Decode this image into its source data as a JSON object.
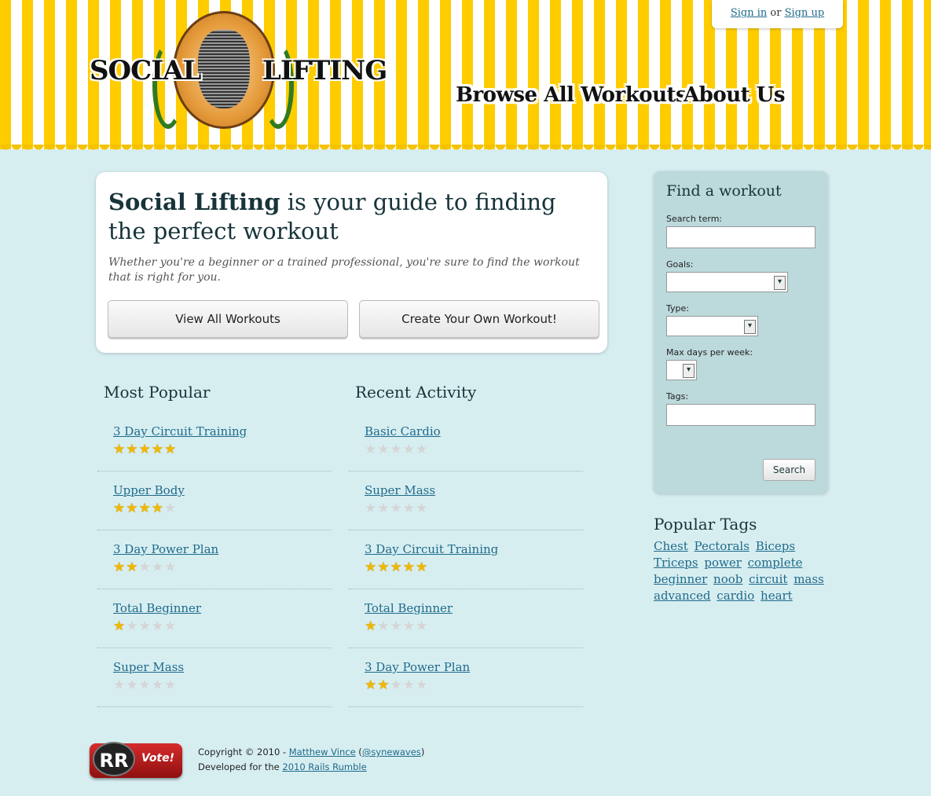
{
  "header": {
    "logo_left": "SOCIAL",
    "logo_right": "LIFTING",
    "auth": {
      "sign_in": "Sign in",
      "or": "or",
      "sign_up": "Sign up"
    },
    "nav": [
      {
        "label": "Browse All Workouts"
      },
      {
        "label": "About Us"
      }
    ]
  },
  "intro": {
    "headline_strong": "Social Lifting",
    "headline_rest": " is your guide to finding the perfect workout",
    "subtext": "Whether you're a beginner or a trained professional, you're sure to find the workout that is right for you.",
    "btn_view_all": "View All Workouts",
    "btn_create": "Create Your Own Workout!"
  },
  "most_popular": {
    "title": "Most Popular",
    "items": [
      {
        "name": "3 Day Circuit Training",
        "rating": 5
      },
      {
        "name": "Upper Body",
        "rating": 4
      },
      {
        "name": "3 Day Power Plan",
        "rating": 2
      },
      {
        "name": "Total Beginner",
        "rating": 1
      },
      {
        "name": "Super Mass",
        "rating": 0
      }
    ]
  },
  "recent_activity": {
    "title": "Recent Activity",
    "items": [
      {
        "name": "Basic Cardio",
        "rating": 0
      },
      {
        "name": "Super Mass",
        "rating": 0
      },
      {
        "name": "3 Day Circuit Training",
        "rating": 5
      },
      {
        "name": "Total Beginner",
        "rating": 1
      },
      {
        "name": "3 Day Power Plan",
        "rating": 2
      }
    ]
  },
  "find": {
    "title": "Find a workout",
    "search_term_label": "Search term:",
    "goals_label": "Goals:",
    "type_label": "Type:",
    "max_days_label": "Max days per week:",
    "tags_label": "Tags:",
    "search_button": "Search"
  },
  "popular_tags": {
    "title": "Popular Tags",
    "tags": [
      "Chest",
      "Pectorals",
      "Biceps",
      "Triceps",
      "power",
      "complete",
      "beginner",
      "noob",
      "circuit",
      "mass",
      "advanced",
      "cardio",
      "heart"
    ]
  },
  "footer": {
    "vote_logo": "RR",
    "vote_label": "Vote!",
    "copyright": "Copyright © 2010 - ",
    "author": "Matthew Vince",
    "handle_open": " (",
    "handle": "@synewaves",
    "handle_close": ")",
    "developed_for": "Developed for the ",
    "event": "2010 Rails Rumble"
  }
}
